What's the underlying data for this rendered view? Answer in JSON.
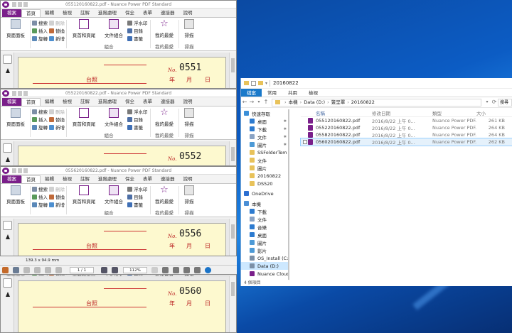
{
  "ribbon": {
    "tabs": [
      "檔案",
      "首頁",
      "編輯",
      "檢視",
      "註解",
      "進階處理",
      "保全",
      "表單",
      "連接器",
      "說明"
    ],
    "find": "搜索",
    "delete": "刪除",
    "insert": "插入",
    "replace": "替換",
    "rotate": "旋轉",
    "add": "新增",
    "page_panel": "頁面面板",
    "header_footer": "頁首和頁尾",
    "doc_assembly": "文件組合",
    "watermark": "浮水印",
    "toc": "目錄",
    "bookmark": "書籤",
    "favorites": "我的最愛",
    "scan": "掃描",
    "group_assemble": "組合",
    "group_favorites": "我的最愛",
    "group_scan": "掃描"
  },
  "windows": [
    {
      "title": "055120160822.pdf - Nuance Power PDF Standard",
      "doc_no": "0551",
      "show_taizhao": true
    },
    {
      "title": "055220160822.pdf - Nuance Power PDF Standard",
      "doc_no": "0552",
      "show_taizhao": false
    },
    {
      "title": "055620160822.pdf - Nuance Power PDF Standard",
      "doc_no": "0556",
      "show_taizhao": true
    },
    {
      "title": "",
      "doc_no": "0560",
      "show_taizhao": true
    }
  ],
  "form_labels": {
    "no": "No.",
    "taizhao": "台照",
    "year": "年",
    "month": "月",
    "day": "日"
  },
  "bottombar": {
    "size": "139.3 x 94.9 mm",
    "page": "1 / 1",
    "zoom": "112%"
  },
  "explorer": {
    "title": "20160822",
    "tabs": [
      "檔案",
      "常用",
      "共用",
      "檢視"
    ],
    "breadcrumb": [
      "本機",
      "Data (D:)",
      "簽呈單",
      "20160822"
    ],
    "search_placeholder": "搜尋 20160822",
    "nav": [
      {
        "label": "快速存取",
        "color": "#3b8fd8",
        "pin": false
      },
      {
        "label": "桌面",
        "color": "#2d7bd0",
        "pin": true
      },
      {
        "label": "下載",
        "color": "#2d7bd0",
        "pin": true
      },
      {
        "label": "文件",
        "color": "#8aa3c4",
        "pin": true
      },
      {
        "label": "圖片",
        "color": "#4d9ad6",
        "pin": true
      },
      {
        "label": "SSFolderTem",
        "color": "#e8c25a",
        "pin": false
      },
      {
        "label": "文件",
        "color": "#e8c25a",
        "pin": false
      },
      {
        "label": "圖片",
        "color": "#e8c25a",
        "pin": false
      },
      {
        "label": "20160822",
        "color": "#e8c25a",
        "pin": false
      },
      {
        "label": "DS520",
        "color": "#e8c25a",
        "pin": false
      },
      {
        "label": "OneDrive",
        "color": "#2b6fd1",
        "pin": false
      },
      {
        "label": "本機",
        "color": "#4a8fd6",
        "pin": false
      },
      {
        "label": "下載",
        "color": "#2d7bd0",
        "pin": false
      },
      {
        "label": "文件",
        "color": "#8aa3c4",
        "pin": false
      },
      {
        "label": "音樂",
        "color": "#2d7bd0",
        "pin": false
      },
      {
        "label": "桌面",
        "color": "#2d7bd0",
        "pin": false
      },
      {
        "label": "圖片",
        "color": "#4d9ad6",
        "pin": false
      },
      {
        "label": "影片",
        "color": "#4d9ad6",
        "pin": false
      },
      {
        "label": "OS_Install (C:)",
        "color": "#7b8fa6",
        "pin": false
      },
      {
        "label": "Data (D:)",
        "color": "#7b8fa6",
        "pin": false
      },
      {
        "label": "Nuance Cloud Connector",
        "color": "#7a1f8a",
        "pin": false
      }
    ],
    "columns": {
      "name": "名稱",
      "date": "修改日期",
      "type": "類型",
      "size": "大小"
    },
    "files": [
      {
        "name": "055120160822.pdf",
        "date": "2016/8/22 上午 0...",
        "type": "Nuance Power PDF...",
        "size": "261 KB"
      },
      {
        "name": "055220160822.pdf",
        "date": "2016/8/22 上午 0...",
        "type": "Nuance Power PDF...",
        "size": "264 KB"
      },
      {
        "name": "055820160822.pdf",
        "date": "2016/8/22 上午 0...",
        "type": "Nuance Power PDF...",
        "size": "264 KB"
      },
      {
        "name": "056020160822.pdf",
        "date": "2016/8/22 上午 0...",
        "type": "Nuance Power PDF...",
        "size": "262 KB"
      }
    ],
    "status": "4 個項目"
  }
}
